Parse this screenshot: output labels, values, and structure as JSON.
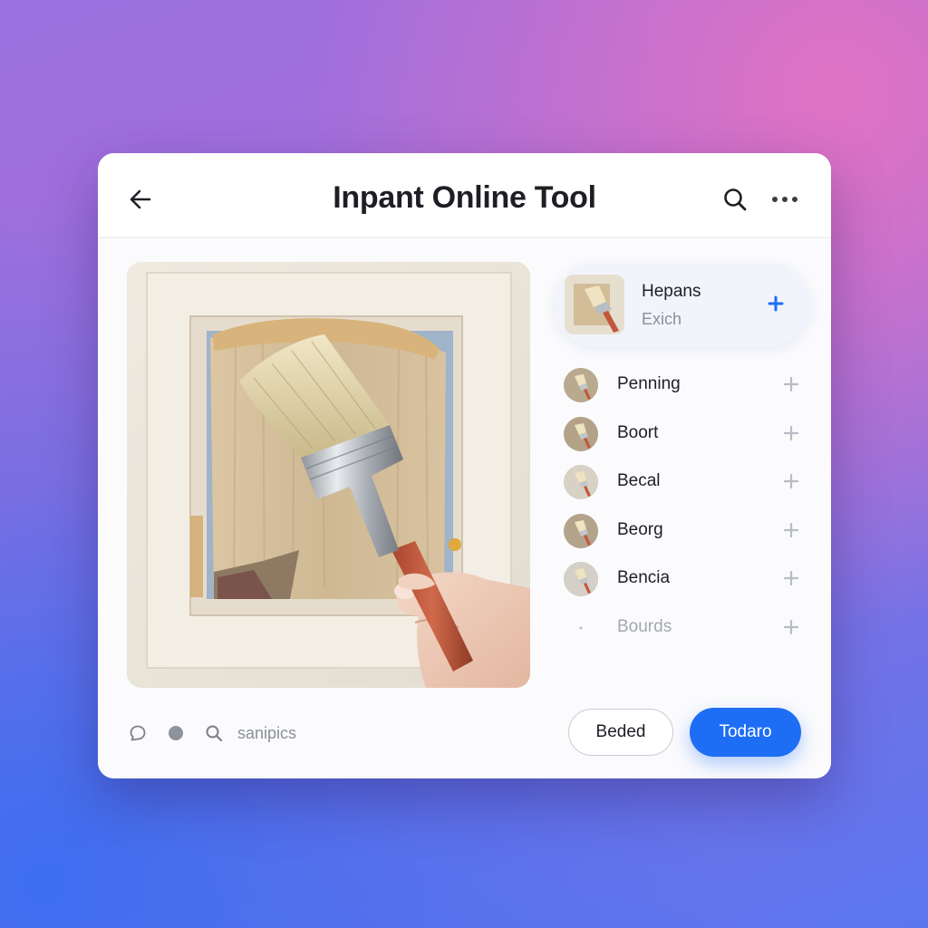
{
  "window": {
    "title": "Inpant Online Tool"
  },
  "header": {
    "back_icon": "arrow-left-icon",
    "search_icon": "search-icon",
    "more_icon": "more-horizontal-icon"
  },
  "active_layer": {
    "title": "Hepans",
    "subtitle": "Exich",
    "action_icon": "plus-icon",
    "accent": "#1e6df5"
  },
  "layers": [
    {
      "label": "Penning",
      "action_icon": "plus-icon"
    },
    {
      "label": "Boort",
      "action_icon": "plus-icon"
    },
    {
      "label": "Becal",
      "action_icon": "plus-icon"
    },
    {
      "label": "Beorg",
      "action_icon": "plus-icon"
    },
    {
      "label": "Bencia",
      "action_icon": "plus-icon"
    },
    {
      "label": "Bourds",
      "action_icon": "plus-icon"
    }
  ],
  "footer": {
    "icons": [
      "chat-bubble-icon",
      "dot-icon",
      "search-icon"
    ],
    "search_text": "sanipics",
    "secondary_button": "Beded",
    "primary_button": "Todaro"
  },
  "colors": {
    "primary": "#1e6df5",
    "text": "#1d1f24",
    "muted": "#8a8f99"
  }
}
